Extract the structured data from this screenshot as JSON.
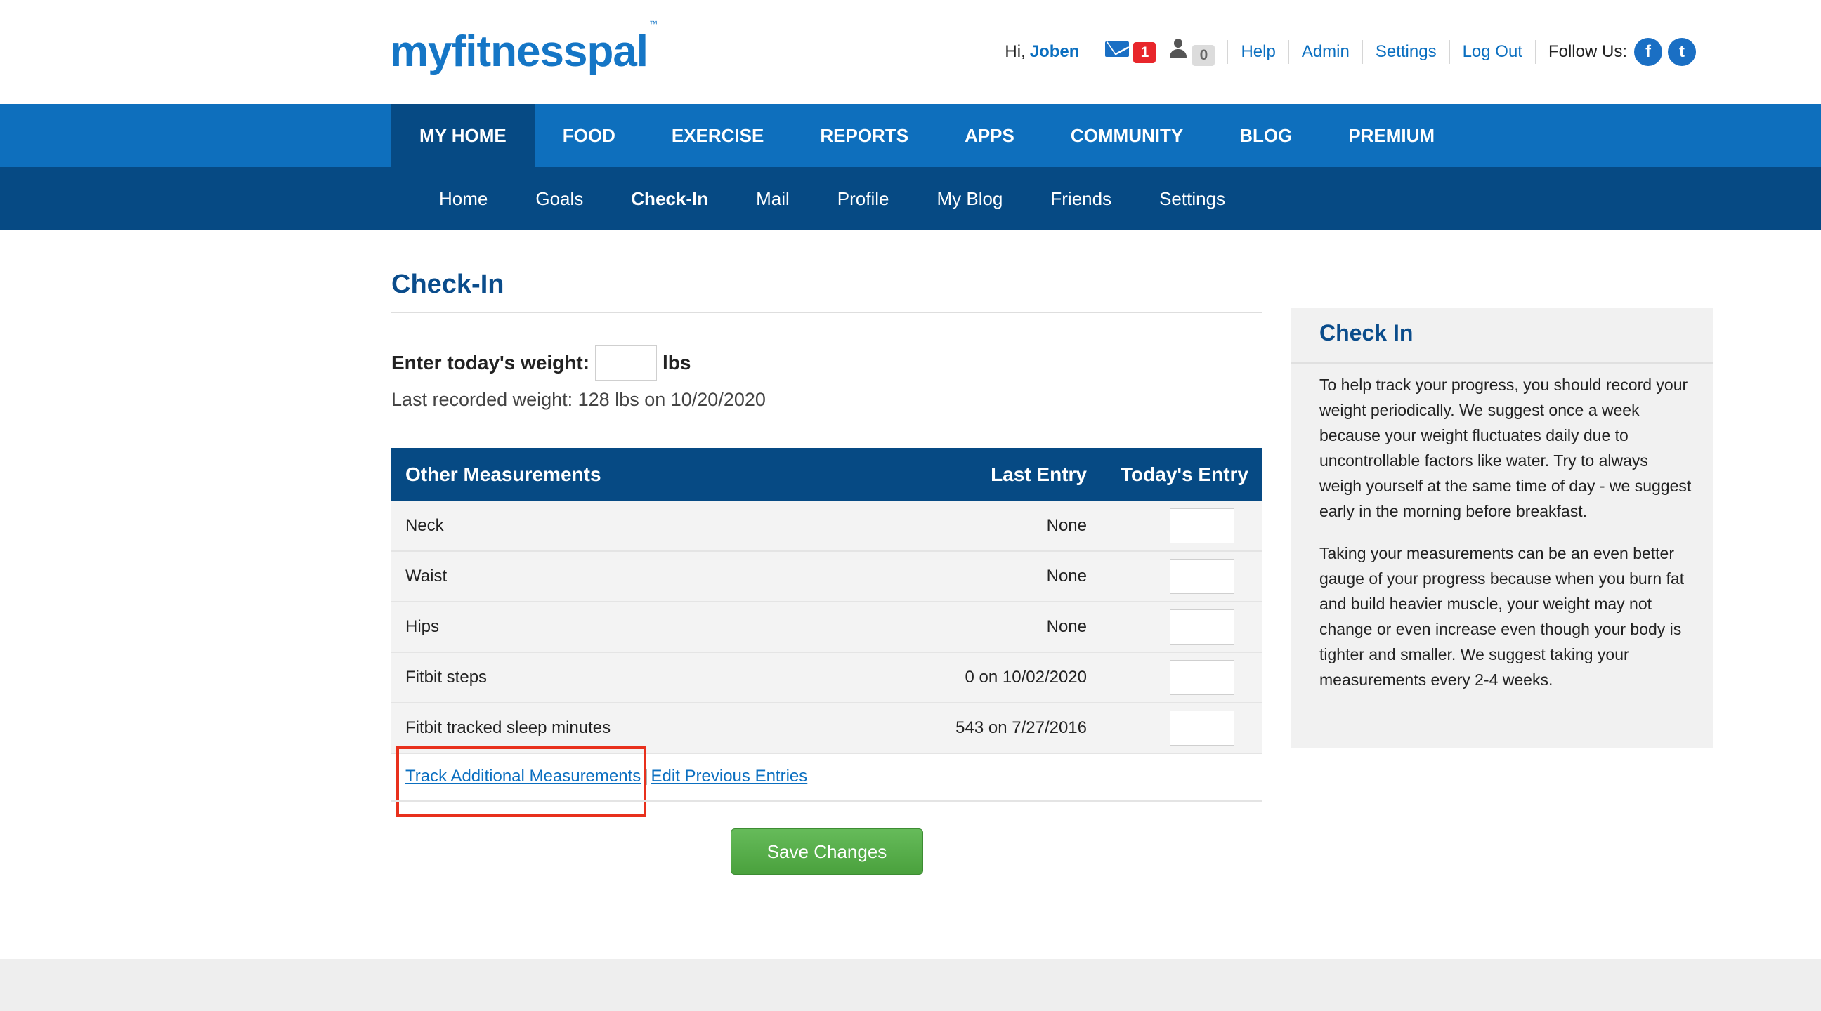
{
  "header": {
    "logo": "myfitnesspal",
    "logo_tm": "™",
    "greeting": "Hi,",
    "username": "Joben",
    "mail_count": "1",
    "friend_requests": "0",
    "links": [
      "Help",
      "Admin",
      "Settings",
      "Log Out"
    ],
    "follow_label": "Follow Us:",
    "facebook": "f",
    "twitter": "t"
  },
  "nav": {
    "primary": [
      "MY HOME",
      "FOOD",
      "EXERCISE",
      "REPORTS",
      "APPS",
      "COMMUNITY",
      "BLOG",
      "PREMIUM"
    ],
    "primary_active": "MY HOME",
    "secondary": [
      "Home",
      "Goals",
      "Check-In",
      "Mail",
      "Profile",
      "My Blog",
      "Friends",
      "Settings"
    ],
    "secondary_active": "Check-In"
  },
  "main": {
    "title": "Check-In",
    "weight_label": "Enter today's weight:",
    "weight_unit": "lbs",
    "weight_value": "",
    "last_weight": "Last recorded weight: 128 lbs on 10/20/2020",
    "table": {
      "headers": [
        "Other Measurements",
        "Last Entry",
        "Today's Entry"
      ],
      "rows": [
        {
          "name": "Neck",
          "last": "None"
        },
        {
          "name": "Waist",
          "last": "None"
        },
        {
          "name": "Hips",
          "last": "None"
        },
        {
          "name": "Fitbit steps",
          "last": "0 on 10/02/2020"
        },
        {
          "name": "Fitbit tracked sleep minutes",
          "last": "543 on 7/27/2016"
        }
      ]
    },
    "track_link": "Track Additional Measurements",
    "separator": "|",
    "edit_link": "Edit Previous Entries",
    "save_button": "Save Changes"
  },
  "sidebar": {
    "title": "Check In",
    "paragraph1": "To help track your progress, you should record your weight periodically. We suggest once a week because your weight fluctuates daily due to uncontrollable factors like water. Try to always weigh yourself at the same time of day - we suggest early in the morning before breakfast.",
    "paragraph2": "Taking your measurements can be an even better gauge of your progress because when you burn fat and build heavier muscle, your weight may not change or even increase even though your body is tighter and smaller. We suggest taking your measurements every 2-4 weeks."
  },
  "colors": {
    "nav_primary": "#0e6fbd",
    "nav_secondary": "#064a84",
    "link": "#0b6fc0",
    "save_button": "#4aa13d",
    "highlight": "#e8301c"
  }
}
